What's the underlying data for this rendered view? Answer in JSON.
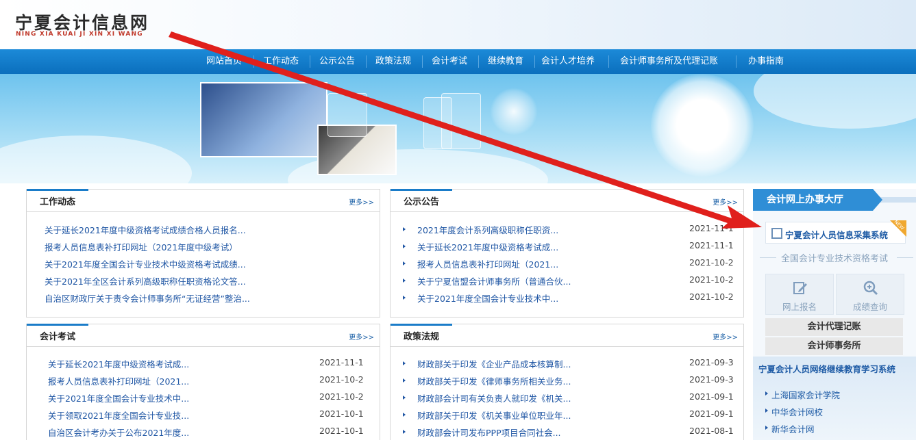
{
  "header": {
    "logo_cn": "宁夏会计信息网",
    "logo_en": "NING XIA KUAI JI XIN XI WANG"
  },
  "nav": [
    {
      "label": "网站首页"
    },
    {
      "label": "工作动态"
    },
    {
      "label": "公示公告"
    },
    {
      "label": "政策法规"
    },
    {
      "label": "会计考试"
    },
    {
      "label": "继续教育"
    },
    {
      "label": "会计人才培养"
    },
    {
      "label": "会计师事务所及代理记账"
    },
    {
      "label": "办事指南"
    }
  ],
  "panels": {
    "work": {
      "title": "工作动态",
      "more": "更多>>",
      "items": [
        {
          "title": "关于延长2021年度中级资格考试成绩合格人员报名..."
        },
        {
          "title": "报考人员信息表补打印网址（2021年度中级考试）"
        },
        {
          "title": "关于2021年度全国会计专业技术中级资格考试成绩..."
        },
        {
          "title": "关于2021年全区会计系列高级职称任职资格论文答..."
        },
        {
          "title": "自治区财政厅关于责令会计师事务所“无证经营”整治..."
        }
      ]
    },
    "notice": {
      "title": "公示公告",
      "more": "更多>>",
      "items": [
        {
          "title": "2021年度会计系列高级职称任职资...",
          "date": "2021-11-1"
        },
        {
          "title": "关于延长2021年度中级资格考试成...",
          "date": "2021-11-1"
        },
        {
          "title": "报考人员信息表补打印网址（2021...",
          "date": "2021-10-2"
        },
        {
          "title": "关于宁夏信盟会计师事务所（普通合伙...",
          "date": "2021-10-2"
        },
        {
          "title": "关于2021年度全国会计专业技术中...",
          "date": "2021-10-2"
        }
      ]
    },
    "exam": {
      "title": "会计考试",
      "more": "更多>>",
      "items": [
        {
          "title": "关于延长2021年度中级资格考试成...",
          "date": "2021-11-1"
        },
        {
          "title": "报考人员信息表补打印网址（2021...",
          "date": "2021-10-2"
        },
        {
          "title": "关于2021年度全国会计专业技术中...",
          "date": "2021-10-2"
        },
        {
          "title": "关于领取2021年度全国会计专业技...",
          "date": "2021-10-1"
        },
        {
          "title": "自治区会计考办关于公布2021年度...",
          "date": "2021-10-1"
        }
      ]
    },
    "policy": {
      "title": "政策法规",
      "more": "更多>>",
      "items": [
        {
          "title": "财政部关于印发《企业产品成本核算制...",
          "date": "2021-09-3"
        },
        {
          "title": "财政部关于印发《律师事务所相关业务...",
          "date": "2021-09-3"
        },
        {
          "title": "财政部会计司有关负责人就印发《机关...",
          "date": "2021-09-1"
        },
        {
          "title": "财政部关于印发《机关事业单位职业年...",
          "date": "2021-09-1"
        },
        {
          "title": "财政部会计司发布PPP项目合同社会...",
          "date": "2021-08-1"
        }
      ]
    }
  },
  "sidebar": {
    "tab": "会计网上办事大厅",
    "collect": "宁夏会计人员信息采集系统",
    "new_badge": "NEW",
    "exam_title": "全国会计专业技术资格考试",
    "tiles": [
      {
        "label": "网上报名"
      },
      {
        "label": "成绩查询"
      }
    ],
    "buttons": [
      {
        "label": "会计代理记账"
      },
      {
        "label": "会计师事务所"
      }
    ],
    "edu_title": "宁夏会计人员网络继续教育学习系统",
    "links": [
      {
        "label": "上海国家会计学院"
      },
      {
        "label": "中华会计网校"
      },
      {
        "label": "新华会计网"
      }
    ]
  },
  "colors": {
    "nav": "#0b6fbd",
    "link": "#1f56a4",
    "annotation_arrow": "#e0201c"
  }
}
